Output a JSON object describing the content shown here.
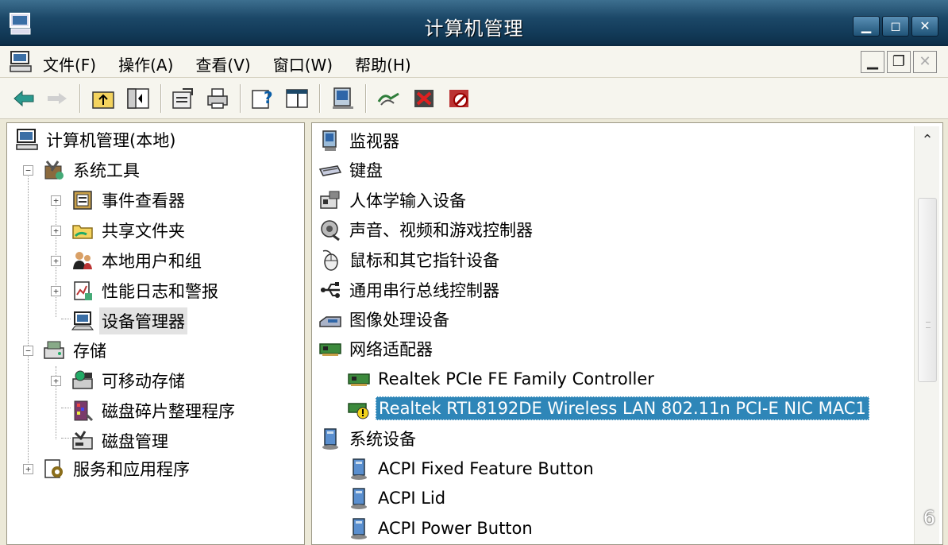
{
  "window": {
    "title": "计算机管理",
    "controls": {
      "minimize": "▁",
      "maximize": "◻",
      "close": "✕"
    }
  },
  "menu": {
    "items": [
      "文件(F)",
      "操作(A)",
      "查看(V)",
      "窗口(W)",
      "帮助(H)"
    ],
    "mdi": {
      "minimize": "▁",
      "restore": "❐",
      "close": "✕"
    }
  },
  "toolbar": {
    "icons": [
      "back-arrow-icon",
      "forward-arrow-icon",
      "up-folder-icon",
      "show-hide-tree-icon",
      "properties-icon",
      "print-icon",
      "help-icon",
      "console-icon",
      "monitor-icon",
      "scan-hardware-icon",
      "uninstall-icon",
      "disable-icon"
    ]
  },
  "tree": {
    "root": "计算机管理(本地)",
    "system_tools": "系统工具",
    "event_viewer": "事件查看器",
    "shared_folders": "共享文件夹",
    "local_users": "本地用户和组",
    "perf_logs": "性能日志和警报",
    "device_manager": "设备管理器",
    "storage": "存储",
    "removable_storage": "可移动存储",
    "defrag": "磁盘碎片整理程序",
    "disk_mgmt": "磁盘管理",
    "services": "服务和应用程序",
    "expand_plus": "+",
    "expand_minus": "−"
  },
  "devices": {
    "monitors": "监视器",
    "keyboards": "键盘",
    "hid": "人体学输入设备",
    "sound": "声音、视频和游戏控制器",
    "mice": "鼠标和其它指针设备",
    "usb": "通用串行总线控制器",
    "imaging": "图像处理设备",
    "network": "网络适配器",
    "nic1": "Realtek PCIe FE Family Controller",
    "nic2": "Realtek RTL8192DE Wireless LAN 802.11n PCI-E NIC MAC1",
    "system": "系统设备",
    "acpi1": "ACPI Fixed Feature Button",
    "acpi2": "ACPI Lid",
    "acpi3": "ACPI Power Button"
  },
  "scrollbar": {
    "up": "⌃"
  },
  "watermark": "6",
  "colors": {
    "titlebar": "#1c4868",
    "selection": "#2e86b8"
  }
}
